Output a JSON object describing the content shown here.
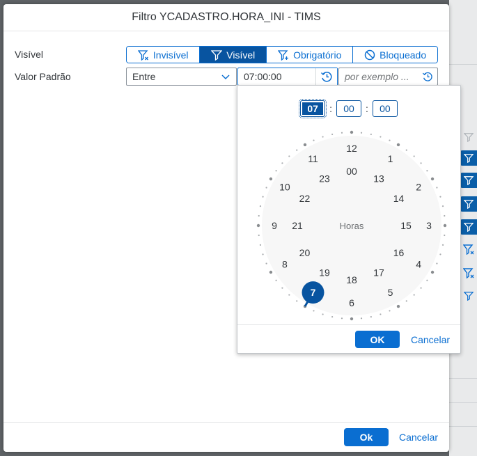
{
  "dialog": {
    "title": "Filtro YCADASTRO.HORA_INI - TIMS",
    "visible_label": "Visível",
    "default_value_label": "Valor Padrão",
    "segments": [
      {
        "label": "Invisível",
        "icon": "filter-remove-icon",
        "active": false
      },
      {
        "label": "Visível",
        "icon": "filter-icon",
        "active": true
      },
      {
        "label": "Obrigatório",
        "icon": "filter-add-icon",
        "active": false
      },
      {
        "label": "Bloqueado",
        "icon": "blocked-icon",
        "active": false
      }
    ],
    "operator": {
      "value": "Entre"
    },
    "from_time": {
      "value": "07:00:00"
    },
    "to_time": {
      "placeholder": "por exemplo ..."
    },
    "ok_label": "Ok",
    "cancel_label": "Cancelar"
  },
  "time_picker": {
    "hours": "07",
    "minutes": "00",
    "seconds": "00",
    "center_label": "Horas",
    "outer_numbers": [
      "12",
      "1",
      "2",
      "3",
      "4",
      "5",
      "6",
      "7",
      "8",
      "9",
      "10",
      "11"
    ],
    "inner_numbers": [
      "00",
      "13",
      "14",
      "15",
      "16",
      "17",
      "18",
      "19",
      "20",
      "21",
      "22",
      "23"
    ],
    "selected_hour": "7",
    "ok_label": "OK",
    "cancel_label": "Cancelar"
  },
  "colors": {
    "accent": "#0a6ed1",
    "selected": "#0854a0"
  }
}
